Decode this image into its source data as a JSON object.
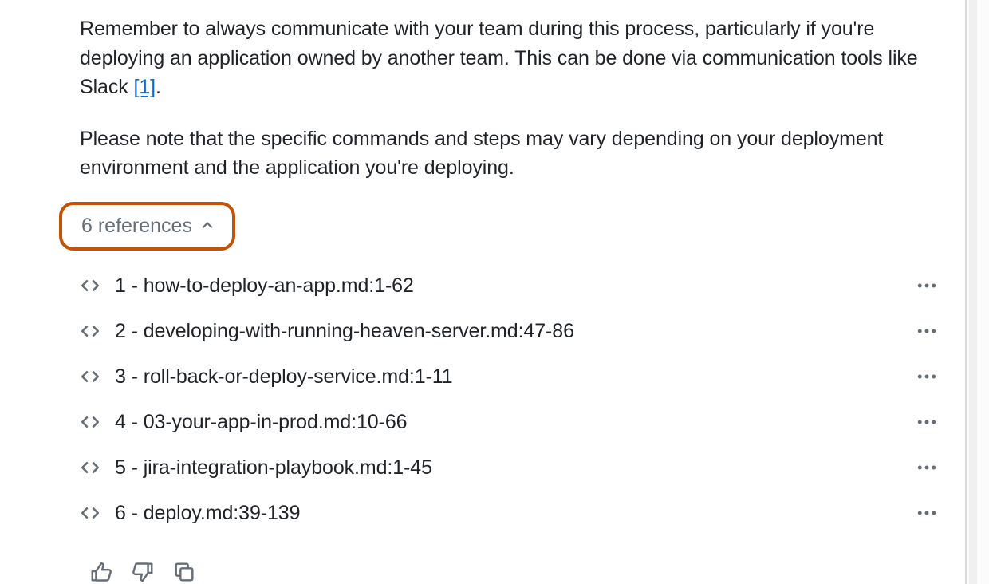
{
  "message": {
    "paragraph1_part1": "Remember to always communicate with your team during this process, particularly if you're deploying an application owned by another team. This can be done via communication tools like Slack ",
    "citation_label": "[1]",
    "paragraph1_part2": ".",
    "paragraph2": "Please note that the specific commands and steps may vary depending on your deployment environment and the application you're deploying."
  },
  "references_toggle": {
    "label": "6 references"
  },
  "references": [
    {
      "label": "1 - how-to-deploy-an-app.md:1-62"
    },
    {
      "label": "2 - developing-with-running-heaven-server.md:47-86"
    },
    {
      "label": "3 - roll-back-or-deploy-service.md:1-11"
    },
    {
      "label": "4 - 03-your-app-in-prod.md:10-66"
    },
    {
      "label": "5 - jira-integration-playbook.md:1-45"
    },
    {
      "label": "6 - deploy.md:39-139"
    }
  ]
}
